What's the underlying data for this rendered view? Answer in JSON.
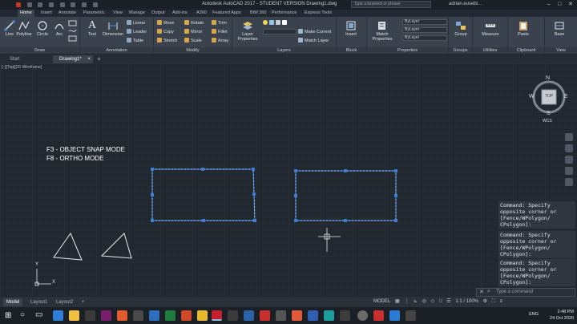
{
  "titlebar": {
    "app_title": "Autodesk AutoCAD 2017 - STUDENT VERSION    Drawing1.dwg",
    "search_placeholder": "Type a keyword or phrase",
    "user": "adrian.eusebi...",
    "minimize": "–",
    "maximize": "□",
    "close": "✕"
  },
  "ribbon_tabs": [
    "Home",
    "Insert",
    "Annotate",
    "Parametric",
    "View",
    "Manage",
    "Output",
    "Add-ins",
    "A360",
    "Featured Apps",
    "BIM 360",
    "Performance",
    "Express Tools"
  ],
  "ribbon": {
    "draw": {
      "title": "Draw",
      "tools": [
        "Line",
        "Polyline",
        "Circle",
        "Arc"
      ]
    },
    "annotation": {
      "title": "Annotation",
      "text": "Text",
      "dimension": "Dimension",
      "linear": "Linear",
      "leader": "Leader",
      "table": "Table"
    },
    "modify": {
      "title": "Modify",
      "move": "Move",
      "rotate": "Rotate",
      "trim": "Trim",
      "copy": "Copy",
      "mirror": "Mirror",
      "fillet": "Fillet",
      "stretch": "Stretch",
      "scale": "Scale",
      "array": "Array"
    },
    "layers": {
      "title": "Layers",
      "layer_properties": "Layer Properties",
      "make_current": "Make Current",
      "match_layer": "Match Layer"
    },
    "block": {
      "title": "Block",
      "insert": "Insert"
    },
    "properties": {
      "title": "Properties",
      "match_properties": "Match Properties",
      "bylayer_1": "ByLayer",
      "bylayer_2": "ByLayer",
      "bylayer_3": "ByLayer"
    },
    "groups": {
      "title": "Groups",
      "group": "Group"
    },
    "utilities": {
      "title": "Utilities",
      "measure": "Measure"
    },
    "clipboard": {
      "title": "Clipboard",
      "paste": "Paste"
    },
    "view": {
      "title": "View",
      "base": "Base"
    }
  },
  "doc_tabs": {
    "start": "Start",
    "drawing": "Drawing1*",
    "close": "×",
    "plus": "+"
  },
  "viewport": {
    "control": "[–][Top][2D Wireframe]",
    "note_1": "F3 - OBJECT SNAP MODE",
    "note_2": "F8 - ORTHO MODE",
    "viewcube": {
      "north": "N",
      "south": "S",
      "east": "E",
      "west": "W",
      "top": "TOP",
      "wcs": "WCS"
    },
    "ucs_x": "X",
    "ucs_y": "Y"
  },
  "command_history": [
    "Command: Specify\nopposite corner or\n[Fence/WPolygon/\nCPolygon]:",
    "Command: Specify\nopposite corner or\n[Fence/WPolygon/\nCPolygon]:",
    "Command: Specify\nopposite corner or\n[Fence/WPolygon/\nCPolygon]:"
  ],
  "command_line_placeholder": "Type a command",
  "status_tabs": [
    "Model",
    "Layout1",
    "Layout2"
  ],
  "status_model": "MODEL",
  "status_scale": "1:1 / 100%",
  "tray": {
    "lang": "ENG",
    "time": "2:48 PM",
    "date": "24 Oct 2020"
  },
  "colors": {
    "background": "#212830",
    "ribbon": "#3a424d",
    "selection": "#3d7fd4"
  }
}
